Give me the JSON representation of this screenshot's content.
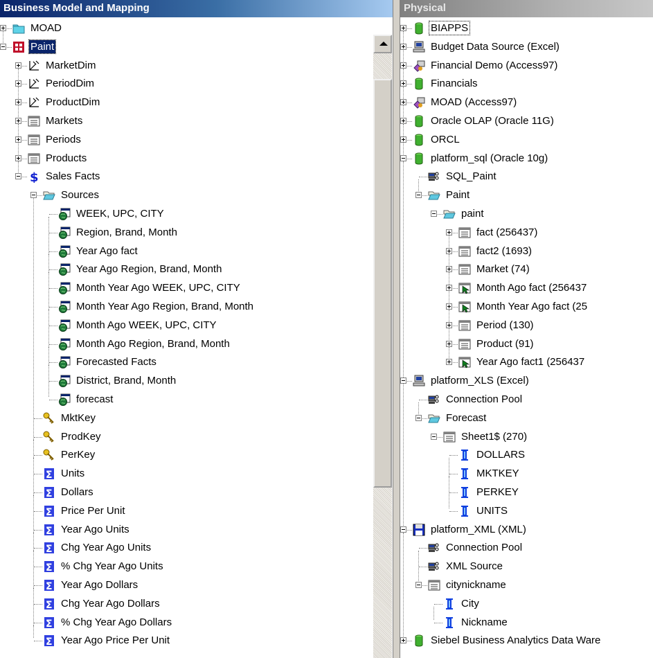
{
  "bmm": {
    "title": "Business Model and Mapping",
    "rows": [
      {
        "label": "MOAD",
        "icon": "folder",
        "d": 0,
        "exp": "plus"
      },
      {
        "label": "Paint",
        "icon": "cube",
        "d": 0,
        "exp": "minus",
        "sel": true
      },
      {
        "label": "MarketDim",
        "icon": "dim",
        "d": 1,
        "exp": "plus"
      },
      {
        "label": "PeriodDim",
        "icon": "dim",
        "d": 1,
        "exp": "plus"
      },
      {
        "label": "ProductDim",
        "icon": "dim",
        "d": 1,
        "exp": "plus"
      },
      {
        "label": "Markets",
        "icon": "table",
        "d": 1,
        "exp": "plus"
      },
      {
        "label": "Periods",
        "icon": "table",
        "d": 1,
        "exp": "plus"
      },
      {
        "label": "Products",
        "icon": "table",
        "d": 1,
        "exp": "plus"
      },
      {
        "label": "Sales Facts",
        "icon": "dollar",
        "d": 1,
        "exp": "minus"
      },
      {
        "label": "Sources",
        "icon": "folderopen",
        "d": 2,
        "exp": "minus"
      },
      {
        "label": "WEEK, UPC, CITY",
        "icon": "source",
        "d": 3
      },
      {
        "label": "Region, Brand, Month",
        "icon": "source",
        "d": 3
      },
      {
        "label": "Year Ago fact",
        "icon": "source",
        "d": 3
      },
      {
        "label": "Year Ago Region, Brand, Month",
        "icon": "source",
        "d": 3
      },
      {
        "label": "Month Year Ago WEEK, UPC, CITY",
        "icon": "source",
        "d": 3
      },
      {
        "label": "Month Year Ago Region, Brand, Month",
        "icon": "source",
        "d": 3
      },
      {
        "label": "Month Ago WEEK, UPC, CITY",
        "icon": "source",
        "d": 3
      },
      {
        "label": "Month Ago Region, Brand, Month",
        "icon": "source",
        "d": 3
      },
      {
        "label": "Forecasted Facts",
        "icon": "source",
        "d": 3
      },
      {
        "label": "District, Brand, Month",
        "icon": "source",
        "d": 3
      },
      {
        "label": "forecast",
        "icon": "source",
        "d": 3
      },
      {
        "label": "MktKey",
        "icon": "key",
        "d": 2
      },
      {
        "label": "ProdKey",
        "icon": "key",
        "d": 2
      },
      {
        "label": "PerKey",
        "icon": "key",
        "d": 2
      },
      {
        "label": "Units",
        "icon": "sigma",
        "d": 2
      },
      {
        "label": "Dollars",
        "icon": "sigma",
        "d": 2
      },
      {
        "label": "Price Per Unit",
        "icon": "sigma",
        "d": 2
      },
      {
        "label": "Year Ago Units",
        "icon": "sigma",
        "d": 2
      },
      {
        "label": "Chg Year Ago Units",
        "icon": "sigma",
        "d": 2
      },
      {
        "label": "% Chg Year Ago Units",
        "icon": "sigma",
        "d": 2
      },
      {
        "label": "Year Ago Dollars",
        "icon": "sigma",
        "d": 2
      },
      {
        "label": "Chg Year Ago Dollars",
        "icon": "sigma",
        "d": 2
      },
      {
        "label": "% Chg Year Ago Dollars",
        "icon": "sigma",
        "d": 2
      },
      {
        "label": "Year Ago Price Per Unit",
        "icon": "sigma",
        "d": 2
      }
    ]
  },
  "physical": {
    "title": "Physical",
    "rows": [
      {
        "label": "BIAPPS",
        "icon": "db",
        "d": 0,
        "exp": "plus",
        "boxed": true
      },
      {
        "label": "Budget Data Source (Excel)",
        "icon": "computer",
        "d": 0,
        "exp": "plus"
      },
      {
        "label": "Financial Demo (Access97)",
        "icon": "access",
        "d": 0,
        "exp": "plus"
      },
      {
        "label": "Financials",
        "icon": "db",
        "d": 0,
        "exp": "plus"
      },
      {
        "label": "MOAD (Access97)",
        "icon": "access",
        "d": 0,
        "exp": "plus"
      },
      {
        "label": "Oracle OLAP (Oracle 11G)",
        "icon": "db",
        "d": 0,
        "exp": "plus"
      },
      {
        "label": "ORCL",
        "icon": "db",
        "d": 0,
        "exp": "plus"
      },
      {
        "label": "platform_sql (Oracle 10g)",
        "icon": "db",
        "d": 0,
        "exp": "minus"
      },
      {
        "label": "SQL_Paint",
        "icon": "pool",
        "d": 1
      },
      {
        "label": "Paint",
        "icon": "folderopen",
        "d": 1,
        "exp": "minus"
      },
      {
        "label": "paint",
        "icon": "folderopen",
        "d": 2,
        "exp": "minus"
      },
      {
        "label": "fact (256437)",
        "icon": "table",
        "d": 3,
        "exp": "plus"
      },
      {
        "label": "fact2 (1693)",
        "icon": "table",
        "d": 3,
        "exp": "plus"
      },
      {
        "label": "Market (74)",
        "icon": "table",
        "d": 3,
        "exp": "plus"
      },
      {
        "label": "Month Ago fact (256437",
        "icon": "alias",
        "d": 3,
        "exp": "plus"
      },
      {
        "label": "Month Year Ago fact (25",
        "icon": "alias",
        "d": 3,
        "exp": "plus"
      },
      {
        "label": "Period (130)",
        "icon": "table",
        "d": 3,
        "exp": "plus"
      },
      {
        "label": "Product (91)",
        "icon": "table",
        "d": 3,
        "exp": "plus"
      },
      {
        "label": "Year Ago fact1 (256437",
        "icon": "alias",
        "d": 3,
        "exp": "plus"
      },
      {
        "label": "platform_XLS (Excel)",
        "icon": "computer",
        "d": 0,
        "exp": "minus"
      },
      {
        "label": "Connection Pool",
        "icon": "pool",
        "d": 1
      },
      {
        "label": "Forecast",
        "icon": "folderopen",
        "d": 1,
        "exp": "minus"
      },
      {
        "label": "Sheet1$ (270)",
        "icon": "table",
        "d": 2,
        "exp": "minus"
      },
      {
        "label": "DOLLARS",
        "icon": "column",
        "d": 3
      },
      {
        "label": "MKTKEY",
        "icon": "column",
        "d": 3
      },
      {
        "label": "PERKEY",
        "icon": "column",
        "d": 3
      },
      {
        "label": "UNITS",
        "icon": "column",
        "d": 3
      },
      {
        "label": "platform_XML (XML)",
        "icon": "floppy",
        "d": 0,
        "exp": "minus"
      },
      {
        "label": "Connection Pool",
        "icon": "pool",
        "d": 1
      },
      {
        "label": "XML Source",
        "icon": "pool",
        "d": 1
      },
      {
        "label": "citynickname",
        "icon": "table",
        "d": 1,
        "exp": "minus"
      },
      {
        "label": "City",
        "icon": "column",
        "d": 2
      },
      {
        "label": "Nickname",
        "icon": "column",
        "d": 2
      },
      {
        "label": "Siebel Business Analytics Data Ware",
        "icon": "db",
        "d": 0,
        "exp": "plus"
      }
    ]
  }
}
